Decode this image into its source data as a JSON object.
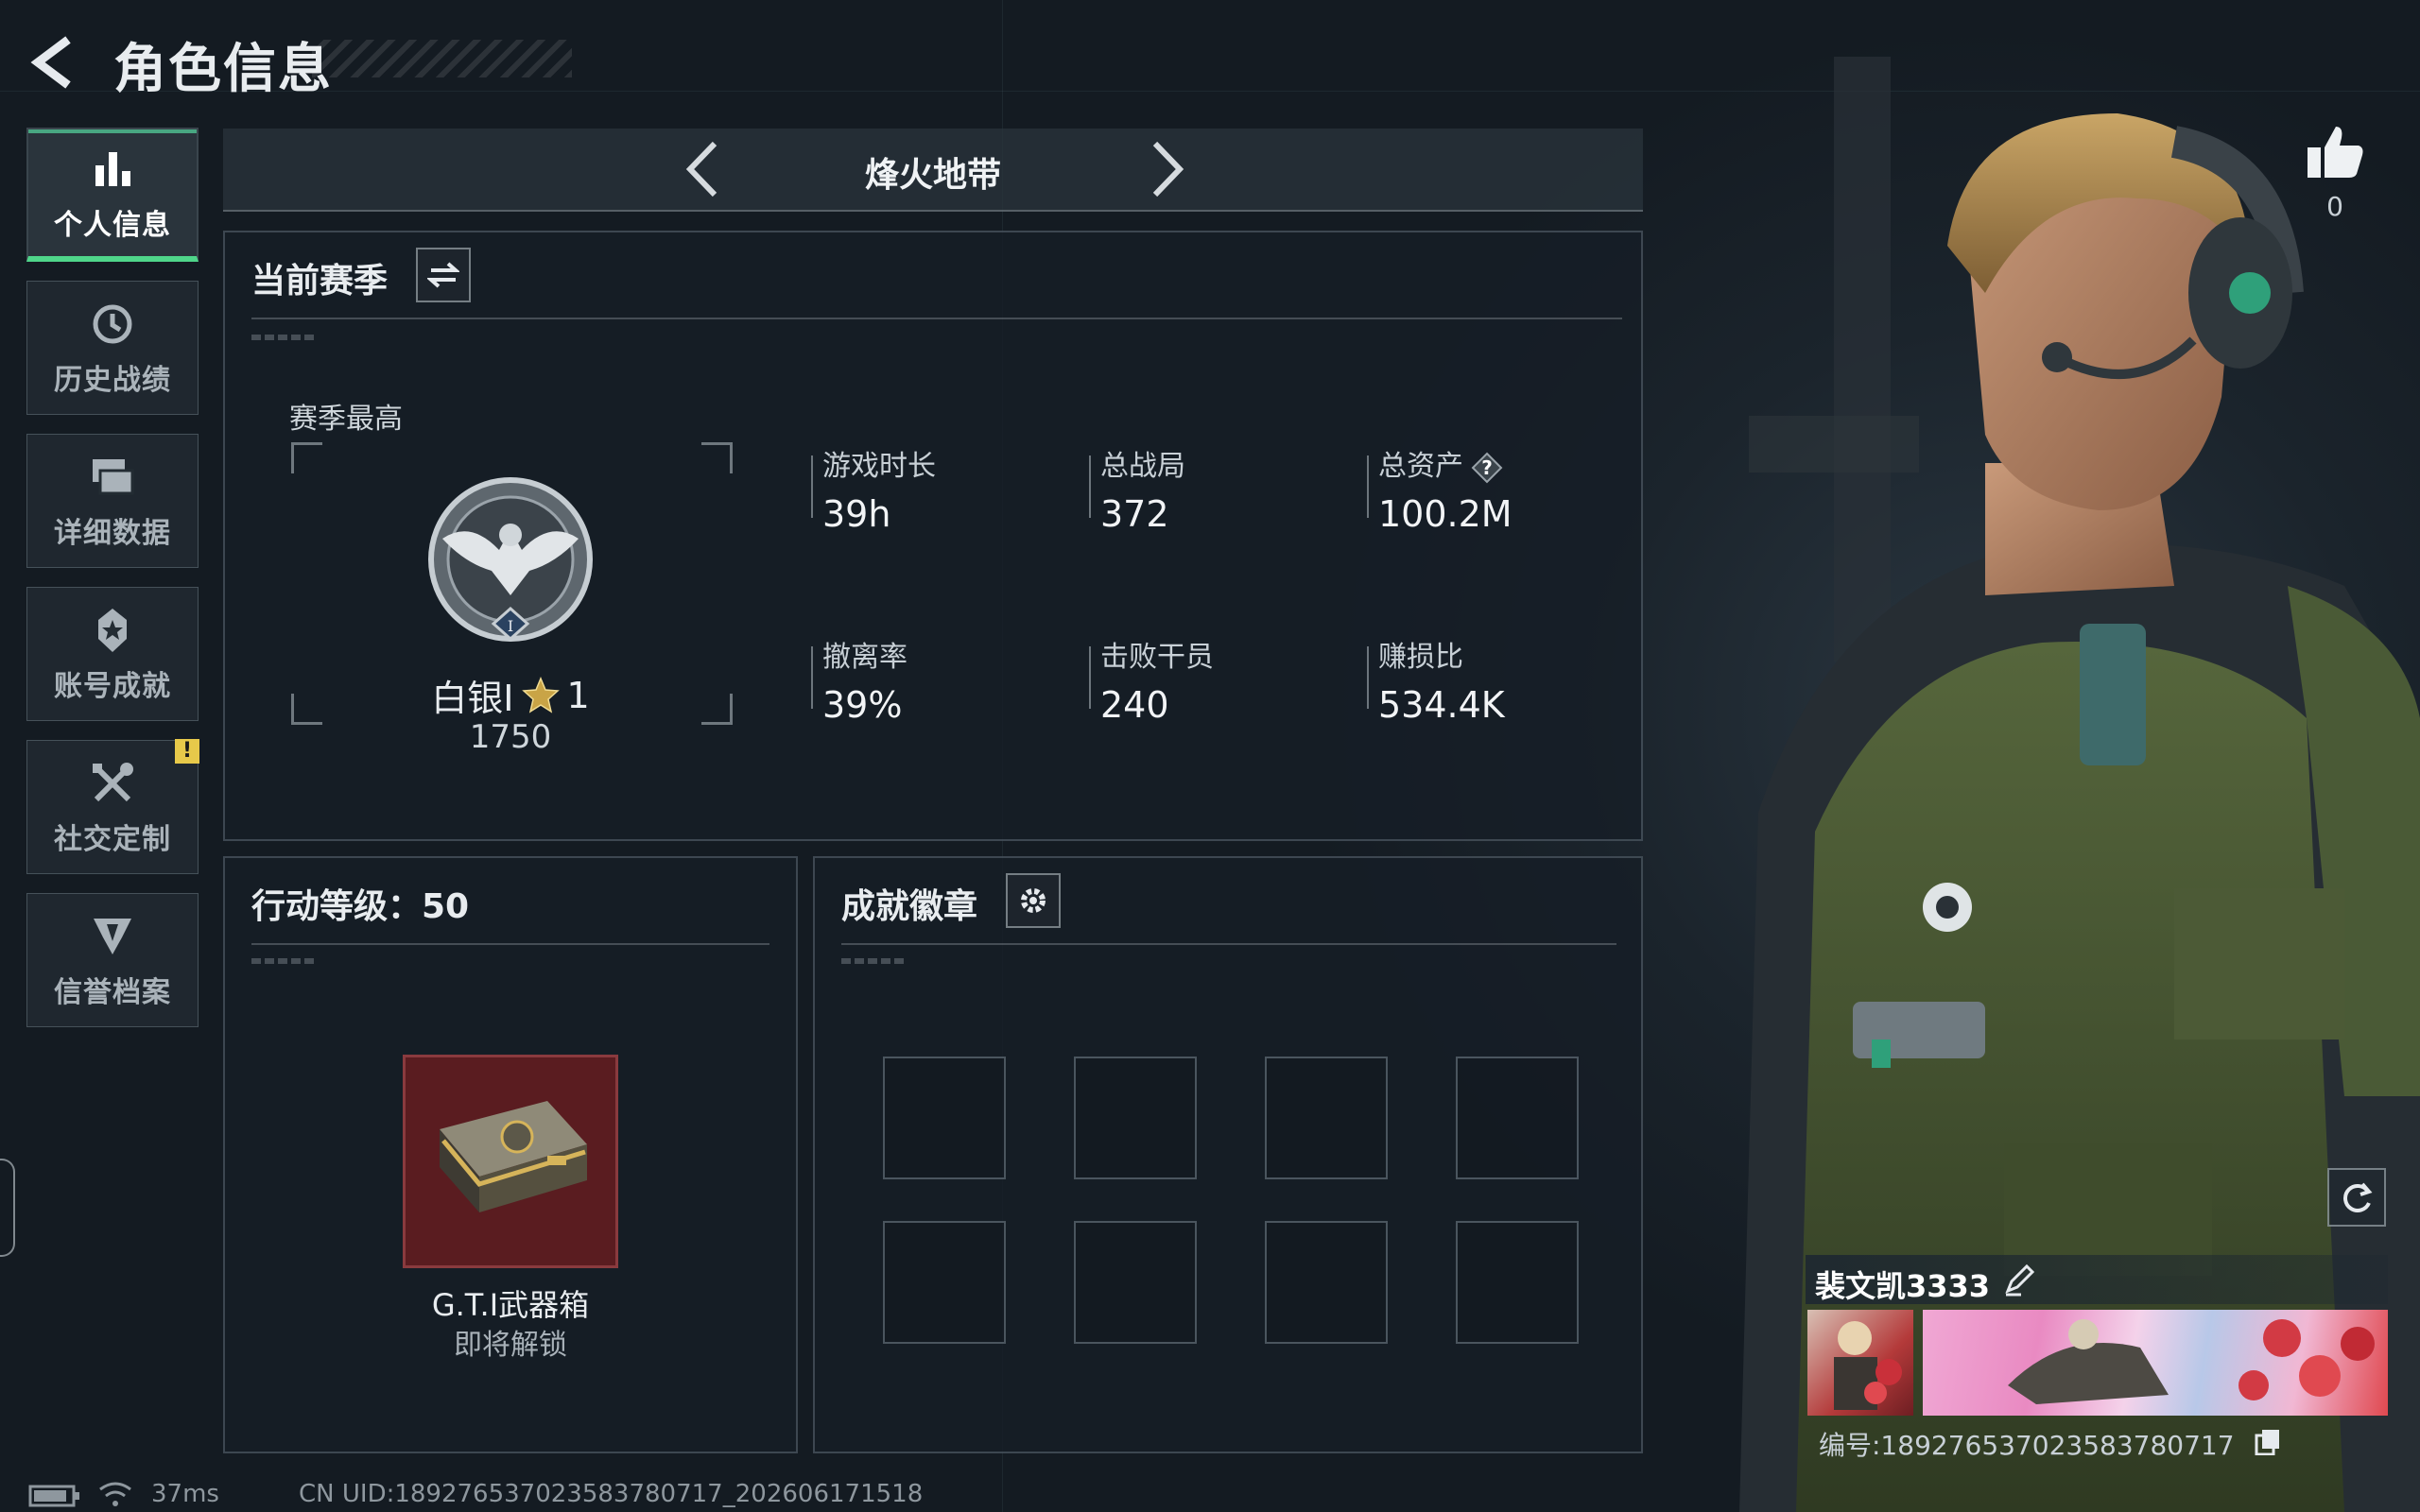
{
  "header": {
    "title": "角色信息"
  },
  "sidebar": {
    "items": [
      {
        "label": "个人信息",
        "icon": "bar-chart-icon",
        "active": true
      },
      {
        "label": "历史战绩",
        "icon": "clock-history-icon",
        "active": false
      },
      {
        "label": "详细数据",
        "icon": "folders-icon",
        "active": false
      },
      {
        "label": "账号成就",
        "icon": "achievement-star-icon",
        "active": false
      },
      {
        "label": "社交定制",
        "icon": "tools-icon",
        "active": false,
        "badge": "!"
      },
      {
        "label": "信誉档案",
        "icon": "shield-emblem-icon",
        "active": false
      }
    ]
  },
  "mode": {
    "title": "烽火地带"
  },
  "season": {
    "title": "当前赛季",
    "best_label": "赛季最高",
    "rank_name": "白银I",
    "rank_stars": "1",
    "rank_score": "1750",
    "rank_tier_letter": "I",
    "stats": [
      {
        "label": "游戏时长",
        "value": "39h"
      },
      {
        "label": "总战局",
        "value": "372"
      },
      {
        "label": "总资产",
        "value": "100.2M",
        "help": "?"
      },
      {
        "label": "撤离率",
        "value": "39%"
      },
      {
        "label": "击败干员",
        "value": "240"
      },
      {
        "label": "赚损比",
        "value": "534.4K"
      }
    ]
  },
  "level": {
    "title": "行动等级：50",
    "reward_name": "G.T.I武器箱",
    "reward_status": "即将解锁"
  },
  "badges": {
    "title": "成就徽章",
    "slots": 8
  },
  "profile": {
    "likes": "0",
    "player_name": "裴文凯3333",
    "uid": "编号:1892765370235837807​17"
  },
  "footer": {
    "ping": "37ms",
    "cn_uid": "CN UID:1892765370235837807​17_202606171518"
  },
  "colors": {
    "accent": "#4fd68a",
    "warn": "#e7c94a",
    "reward_bg": "#5a1c20"
  }
}
